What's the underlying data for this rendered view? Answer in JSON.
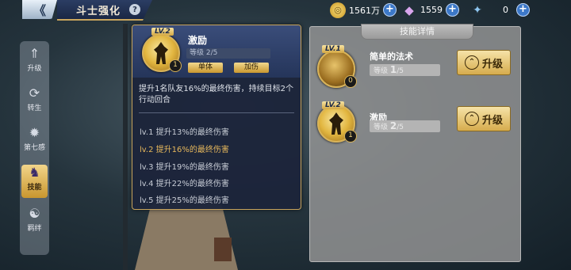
{
  "header": {
    "title": "斗士强化",
    "help": "?",
    "back": "《"
  },
  "resources": [
    {
      "name": "gold",
      "value": "1561万",
      "icon": "coin-icon",
      "color": "#e9c04a"
    },
    {
      "name": "diamond",
      "value": "1559",
      "icon": "diamond-icon",
      "color": "#c78ad8"
    },
    {
      "name": "item",
      "value": "0",
      "icon": "crystal-icon",
      "color": "#6fb2e6"
    }
  ],
  "nav": [
    {
      "label": "升级",
      "icon": "upgrade-icon",
      "active": false
    },
    {
      "label": "转生",
      "icon": "rebirth-icon",
      "active": false
    },
    {
      "label": "第七感",
      "icon": "seventh-sense-icon",
      "active": false
    },
    {
      "label": "技能",
      "icon": "skill-icon",
      "active": true
    },
    {
      "label": "羁绊",
      "icon": "bond-icon",
      "active": false
    }
  ],
  "tooltip": {
    "lv_tag": "LV.2",
    "name": "激励",
    "level_text": "等级 2/5",
    "badge": "1",
    "tags": [
      "单体",
      "加伤"
    ],
    "description": "提升1名队友16%的最终伤害，持续目标2个行动回合",
    "levels": [
      {
        "text": "lv.1 提升13%的最终伤害",
        "current": false
      },
      {
        "text": "lv.2 提升16%的最终伤害",
        "current": true
      },
      {
        "text": "lv.3 提升19%的最终伤害",
        "current": false
      },
      {
        "text": "lv.4 提升22%的最终伤害",
        "current": false
      },
      {
        "text": "lv.5 提升25%的最终伤害",
        "current": false
      }
    ]
  },
  "panel": {
    "title": "技能详情",
    "skills": [
      {
        "lv": "LV.1",
        "name": "简单的法术",
        "level_prefix": "等级",
        "level_cur": "1",
        "level_max": "/5",
        "badge": "0",
        "button": "升级"
      },
      {
        "lv": "LV.2",
        "name": "激励",
        "level_prefix": "等级",
        "level_cur": "2",
        "level_max": "/5",
        "badge": "1",
        "button": "升级"
      }
    ]
  }
}
